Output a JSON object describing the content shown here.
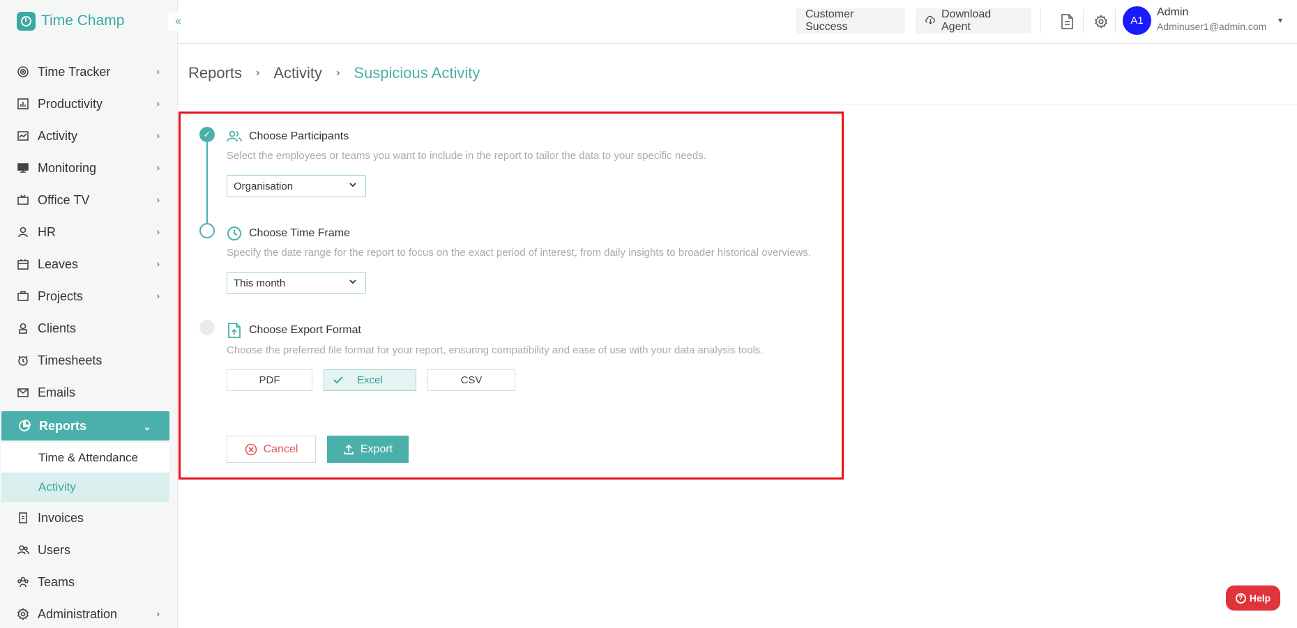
{
  "app": {
    "name": "Time Champ",
    "collapse_icon": "«"
  },
  "sidebar": {
    "items": [
      {
        "label": "Time Tracker",
        "icon": "target-icon"
      },
      {
        "label": "Productivity",
        "icon": "bar-chart-icon"
      },
      {
        "label": "Activity",
        "icon": "activity-icon"
      },
      {
        "label": "Monitoring",
        "icon": "monitor-icon"
      },
      {
        "label": "Office TV",
        "icon": "tv-icon"
      },
      {
        "label": "HR",
        "icon": "person-icon"
      },
      {
        "label": "Leaves",
        "icon": "calendar-icon"
      },
      {
        "label": "Projects",
        "icon": "briefcase-icon"
      },
      {
        "label": "Clients",
        "icon": "client-icon"
      },
      {
        "label": "Timesheets",
        "icon": "alarm-icon"
      },
      {
        "label": "Emails",
        "icon": "mail-icon"
      },
      {
        "label": "Reports",
        "icon": "pie-chart-icon"
      },
      {
        "label": "Invoices",
        "icon": "invoice-icon"
      },
      {
        "label": "Users",
        "icon": "users-icon"
      },
      {
        "label": "Teams",
        "icon": "teams-icon"
      },
      {
        "label": "Administration",
        "icon": "gear-icon"
      }
    ],
    "reports_sub": [
      "Time & Attendance",
      "Activity"
    ]
  },
  "topbar": {
    "customer_success": "Customer Success",
    "download_agent": "Download Agent",
    "avatar_initials": "A1",
    "user_name": "Admin",
    "user_email": "Adminuser1@admin.com"
  },
  "breadcrumb": [
    "Reports",
    "Activity",
    "Suspicious Activity"
  ],
  "form": {
    "step1": {
      "title": "Choose Participants",
      "description": "Select the employees or teams you want to include in the report to tailor the data to your specific needs.",
      "selected": "Organisation"
    },
    "step2": {
      "title": "Choose Time Frame",
      "description": "Specify the date range for the report to focus on the exact period of interest, from daily insights to broader historical overviews.",
      "selected": "This month"
    },
    "step3": {
      "title": "Choose Export Format",
      "description": "Choose the preferred file format for your report, ensuring compatibility and ease of use with your data analysis tools.",
      "formats": [
        "PDF",
        "Excel",
        "CSV"
      ],
      "selected_format": "Excel"
    },
    "cancel_label": "Cancel",
    "export_label": "Export"
  },
  "help_label": "Help",
  "colors": {
    "accent": "#4bb0ab",
    "highlight_border": "#e8121b",
    "avatar": "#1a1aff",
    "help": "#e0343a"
  }
}
